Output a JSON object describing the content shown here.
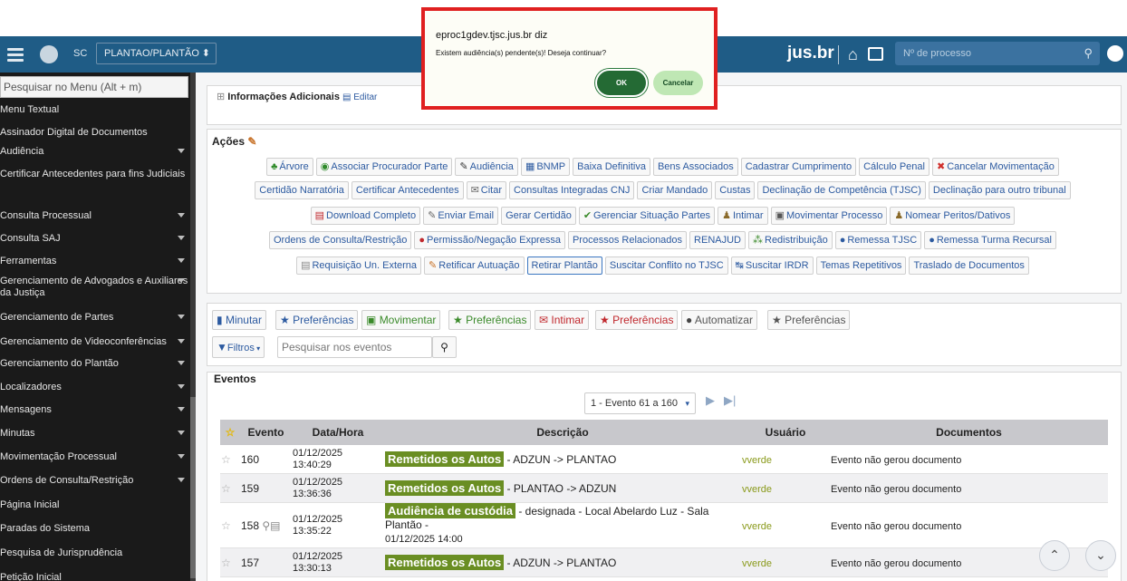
{
  "header": {
    "sc": "SC",
    "role_select": "PLANTAO/PLANTÃO",
    "brand": "jus.br",
    "process_placeholder": "Nº de processo"
  },
  "sidebar": {
    "search_placeholder": "Pesquisar no Menu (Alt + m)",
    "items": [
      {
        "label": "Menu Textual",
        "submenu": false
      },
      {
        "label": "Assinador Digital de Documentos",
        "submenu": false
      },
      {
        "label": "Audiência",
        "submenu": true
      },
      {
        "label": "Certificar Antecedentes para fins Judiciais",
        "submenu": false
      },
      {
        "label": "Consulta Processual",
        "submenu": true
      },
      {
        "label": "Consulta SAJ",
        "submenu": true
      },
      {
        "label": "Ferramentas",
        "submenu": true
      },
      {
        "label": "Gerenciamento de Advogados e Auxiliares da Justiça",
        "submenu": true
      },
      {
        "label": "Gerenciamento de Partes",
        "submenu": true
      },
      {
        "label": "Gerenciamento de Videoconferências",
        "submenu": true
      },
      {
        "label": "Gerenciamento do Plantão",
        "submenu": true
      },
      {
        "label": "Localizadores",
        "submenu": true
      },
      {
        "label": "Mensagens",
        "submenu": true
      },
      {
        "label": "Minutas",
        "submenu": true
      },
      {
        "label": "Movimentação Processual",
        "submenu": true
      },
      {
        "label": "Ordens de Consulta/Restrição",
        "submenu": true
      },
      {
        "label": "Página Inicial",
        "submenu": false
      },
      {
        "label": "Paradas do Sistema",
        "submenu": false
      },
      {
        "label": "Pesquisa de Jurisprudência",
        "submenu": false
      },
      {
        "label": "Petição Inicial",
        "submenu": false
      }
    ]
  },
  "info": {
    "title": "Informações Adicionais",
    "edit": "Editar"
  },
  "actions": {
    "title": "Ações",
    "rows": [
      [
        "Árvore",
        "Associar Procurador Parte",
        "Audiência",
        "BNMP",
        "Baixa Definitiva",
        "Bens Associados",
        "Cadastrar Cumprimento",
        "Cálculo Penal",
        "Cancelar Movimentação"
      ],
      [
        "Certidão Narratória",
        "Certificar Antecedentes",
        "Citar",
        "Consultas Integradas CNJ",
        "Criar Mandado",
        "Custas",
        "Declinação de Competência (TJSC)",
        "Declinação para outro tribunal"
      ],
      [
        "Download Completo",
        "Enviar Email",
        "Gerar Certidão",
        "Gerenciar Situação Partes",
        "Intimar",
        "Movimentar Processo",
        "Nomear Peritos/Dativos"
      ],
      [
        "Ordens de Consulta/Restrição",
        "Permissão/Negação Expressa",
        "Processos Relacionados",
        "RENAJUD",
        "Redistribuição",
        "Remessa TJSC",
        "Remessa Turma Recursal"
      ],
      [
        "Requisição Un. Externa",
        "Retificar Autuação",
        "Retirar Plantão",
        "Suscitar Conflito no TJSC",
        "Suscitar IRDR",
        "Temas Repetitivos",
        "Traslado de Documentos"
      ]
    ]
  },
  "toolbar": {
    "minutar": "Minutar",
    "preferencias": "Preferências",
    "movimentar": "Movimentar",
    "intimar": "Intimar",
    "automatizar": "Automatizar",
    "filtros": "Filtros",
    "search_placeholder": "Pesquisar nos eventos"
  },
  "events": {
    "title": "Eventos",
    "range": "1 - Evento 61 a 160",
    "columns": [
      "Evento",
      "Data/Hora",
      "Descrição",
      "Usuário",
      "Documentos"
    ],
    "rows": [
      {
        "num": "160",
        "date": "01/12/2025",
        "time": "13:40:29",
        "tag": "Remetidos os Autos",
        "desc": " - ADZUN -> PLANTAO",
        "desc2": "",
        "user": "vverde",
        "docs": "Evento não gerou documento"
      },
      {
        "num": "159",
        "date": "01/12/2025",
        "time": "13:36:36",
        "tag": "Remetidos os Autos",
        "desc": " - PLANTAO -> ADZUN",
        "desc2": "",
        "user": "vverde",
        "docs": "Evento não gerou documento"
      },
      {
        "num": "158",
        "date": "01/12/2025",
        "time": "13:35:22",
        "tag": "Audiência de custódia",
        "desc": " - designada - Local Abelardo Luz - Sala Plantão -",
        "desc2": "01/12/2025 14:00",
        "user": "vverde",
        "docs": "Evento não gerou documento"
      },
      {
        "num": "157",
        "date": "01/12/2025",
        "time": "13:30:13",
        "tag": "Remetidos os Autos",
        "desc": " - ADZUN -> PLANTAO",
        "desc2": "",
        "user": "vverde",
        "docs": "Evento não gerou documento"
      }
    ]
  },
  "dialog": {
    "title": "eproc1gdev.tjsc.jus.br diz",
    "message": "Existem audiência(s) pendente(s)! Deseja continuar?",
    "ok": "OK",
    "cancel": "Cancelar"
  }
}
